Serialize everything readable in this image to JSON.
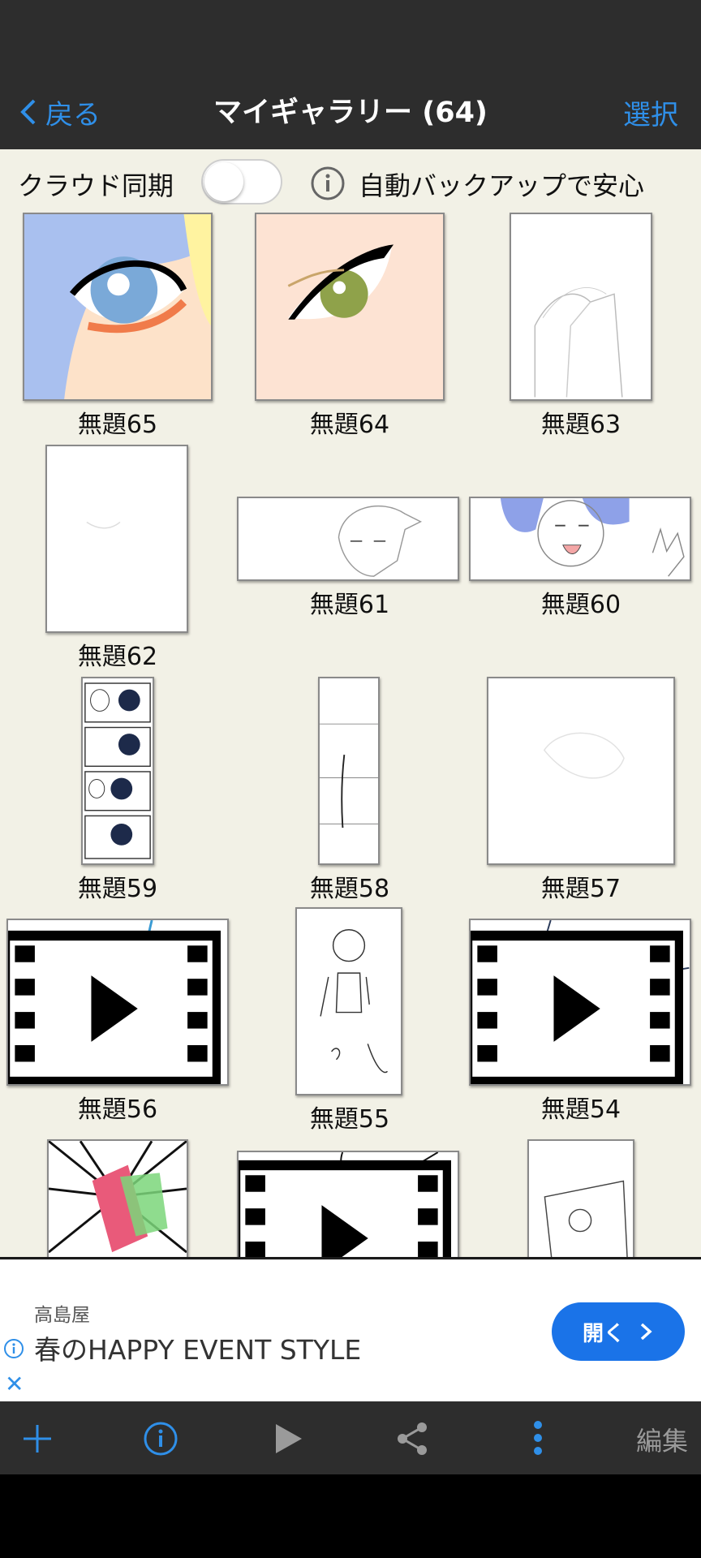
{
  "header": {
    "back_label": "戻る",
    "title": "マイギャラリー (64)",
    "select_label": "選択"
  },
  "sync": {
    "label": "クラウド同期",
    "toggle_on": false,
    "info_text": "自動バックアップで安心"
  },
  "gallery": {
    "items": [
      {
        "label": "無題65",
        "video": false
      },
      {
        "label": "無題64",
        "video": false
      },
      {
        "label": "無題63",
        "video": false
      },
      {
        "label": "無題62",
        "video": false
      },
      {
        "label": "無題61",
        "video": false
      },
      {
        "label": "無題60",
        "video": false
      },
      {
        "label": "無題59",
        "video": false
      },
      {
        "label": "無題58",
        "video": false
      },
      {
        "label": "無題57",
        "video": false
      },
      {
        "label": "無題56",
        "video": true
      },
      {
        "label": "無題55",
        "video": false
      },
      {
        "label": "無題54",
        "video": true
      }
    ]
  },
  "ad": {
    "brand": "高島屋",
    "text": "春のHAPPY EVENT STYLE",
    "button_label": "開く"
  },
  "toolbar": {
    "icons": [
      "add-icon",
      "info-icon",
      "play-icon",
      "share-icon",
      "more-icon"
    ],
    "edit_label": "編集"
  },
  "colors": {
    "accent": "#2f8fe8",
    "topbar": "#2d2d2d",
    "background": "#f2f1e6",
    "ad_button": "#1a73e8"
  }
}
